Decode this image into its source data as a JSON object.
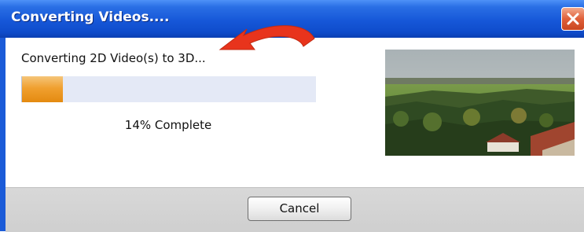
{
  "window": {
    "title": "Converting Videos....",
    "close_icon": "close-icon"
  },
  "status": {
    "message": "Converting 2D Video(s) to 3D..."
  },
  "progress": {
    "percent": 14,
    "label": "14% Complete"
  },
  "preview": {
    "icon": "video-preview-thumbnail"
  },
  "buttons": {
    "cancel_label": "Cancel"
  },
  "annotation": {
    "icon": "red-arrow-icon",
    "color": "#e8341c"
  },
  "colors": {
    "titlebar": "#1657d8",
    "progress_fill": "#f0a030",
    "progress_track": "#e4e9f6",
    "close_button": "#e0603a"
  }
}
